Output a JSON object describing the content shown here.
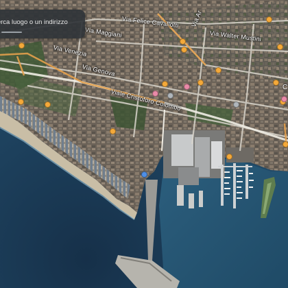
{
  "search": {
    "placeholder": "Cerca luogo o un indirizzo",
    "value": ""
  },
  "streets": {
    "felice_cavallotti": "Via Felice Cavallotti",
    "maggiani": "Via Maggiani",
    "venezia": "Via Venezia",
    "genova": "Via Genova",
    "walter_mustini": "Via Walter Mustini",
    "cristoforo_colombo": "Viale Cristoforo Colombo",
    "top_vertical": "Via Ar"
  },
  "edge_label": "C",
  "colors": {
    "sea": "#1d3a55",
    "sea_light": "#2a5878",
    "road_orange": "#e4a04c",
    "poi_orange": "#f4a93a",
    "poi_pink": "#e98aa8",
    "poi_blue": "#4f8fe6"
  }
}
